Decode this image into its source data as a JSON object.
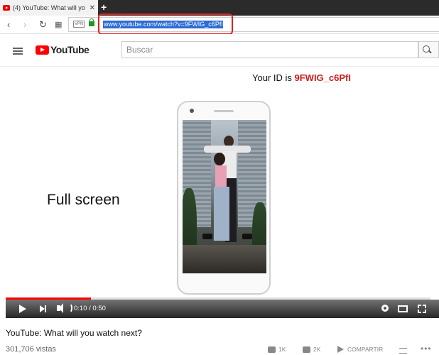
{
  "browser": {
    "tab_title": "(4) YouTube: What will yo",
    "tab_close": "✕",
    "new_tab": "+",
    "nav": {
      "back": "‹",
      "forward": "›",
      "reload": "↻",
      "grid": "▦"
    },
    "vpn_label": "VPN",
    "url": "www.youtube.com/watch?v=9FWIG_c6Pfl"
  },
  "youtube": {
    "logo_text": "YouTube",
    "search_placeholder": "Buscar"
  },
  "video": {
    "overlay_id_label": "Your ID is ",
    "overlay_id_value": "9FWIG_c6PfI",
    "overlay_fullscreen": "Full screen",
    "time": "0:10 / 0:50",
    "progress": 0.2
  },
  "below": {
    "title": "YouTube: What will you watch next?",
    "views": "301,706 vistas",
    "likes": "1K",
    "dislikes": "2K",
    "share": "COMPARTIR",
    "more": "•••"
  }
}
